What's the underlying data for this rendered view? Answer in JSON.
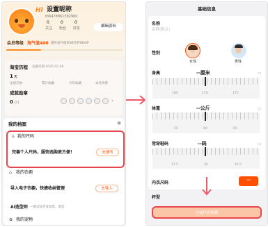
{
  "profile": {
    "title": "设置昵称",
    "id": "tb6478861382960",
    "stats": [
      {
        "value": "0",
        "label": "关注"
      },
      {
        "value": "0",
        "label": "粉丝"
      },
      {
        "value": "0",
        "label": "好友"
      }
    ],
    "edit_label": "编辑资料"
  },
  "member": {
    "label": "会员等级",
    "value": "淘气值400",
    "desc": "提升淘气值享88元开88VIP"
  },
  "history": {
    "title": "淘宝历程",
    "date": "注册日期 2026.02.08",
    "days": "1",
    "days_unit": "天",
    "cols": [
      "注册天数",
      "累计收藏",
      "今年收藏",
      "本月消费"
    ],
    "badge_title": "成就勋章",
    "badge_count": "0",
    "badge_total": "/21"
  },
  "archive": {
    "title": "我的档案",
    "size_title": "我的尺码",
    "size_text": "完善个人尺码，服饰选购更方便！",
    "size_btn": "去填写",
    "wardrobe_title": "我的衣橱",
    "wardrobe_text": "导入电子衣橱，快捷收纳管理",
    "wardrobe_btn": "去导入",
    "ai_title": "AI造型师",
    "ai_text": "一键试穿百变穿搭、发型",
    "pet_title": "我的宠物"
  },
  "form": {
    "page_title": "基础信息",
    "name_label": "名称",
    "name_placeholder": "名称(默认)",
    "gender_label": "性别",
    "female": "女性",
    "male": "男性",
    "height_label": "身高",
    "height_value": "--厘米",
    "height_ticks": [
      "165",
      "170",
      "175"
    ],
    "weight_label": "体重",
    "weight_value": "--公斤",
    "weight_ticks": [
      "55",
      "60",
      "65"
    ],
    "shoe_label": "常穿鞋码",
    "shoe_value": "--码",
    "shoe_ticks": [
      "37.5",
      "40",
      "42.5"
    ],
    "underwear_label": "内衣尺码",
    "underwear_btn": "--",
    "cup_label": "杯型",
    "submit": "生成尺码档案"
  },
  "colors": {
    "accent": "#ff5000",
    "highlight": "#e8464c",
    "arrow": "#ef5b66"
  }
}
